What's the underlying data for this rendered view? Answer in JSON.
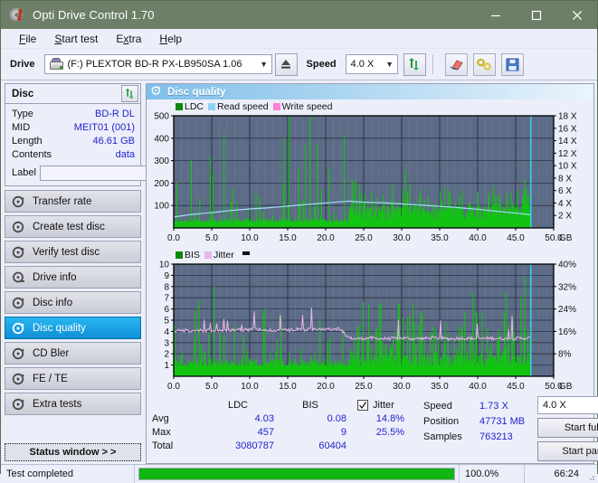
{
  "window": {
    "title": "Opti Drive Control 1.70",
    "icon": "disc-icon",
    "controls": {
      "minimize": "minimize-icon",
      "maximize": "maximize-icon",
      "close": "close-icon"
    }
  },
  "menubar": {
    "items": [
      {
        "label": "File",
        "accel": "F"
      },
      {
        "label": "Start test",
        "accel": "S"
      },
      {
        "label": "Extra",
        "accel": "x"
      },
      {
        "label": "Help",
        "accel": "H"
      }
    ]
  },
  "toolbar": {
    "drive_label": "Drive",
    "drive_value": "(F:)   PLEXTOR BD-R  PX-LB950SA 1.06",
    "eject_icon": "eject-icon",
    "speed_label": "Speed",
    "speed_value": "4.0 X",
    "refresh_icon": "refresh-icon",
    "erase_icon": "eraser-icon",
    "tools_icon": "tools-icon",
    "save_icon": "save-icon"
  },
  "disc": {
    "header": "Disc",
    "refresh_icon": "refresh-icon",
    "rows": [
      {
        "key": "Type",
        "value": "BD-R DL"
      },
      {
        "key": "MID",
        "value": "MEIT01 (001)"
      },
      {
        "key": "Length",
        "value": "46.61 GB"
      },
      {
        "key": "Contents",
        "value": "data"
      }
    ],
    "label_key": "Label",
    "label_value": "",
    "label_placeholder": "",
    "label_button_icon": "cd-icon"
  },
  "nav": {
    "items": [
      {
        "label": "Transfer rate",
        "icon": "disc-test-icon",
        "active": false
      },
      {
        "label": "Create test disc",
        "icon": "disc-burn-icon",
        "active": false
      },
      {
        "label": "Verify test disc",
        "icon": "disc-verify-icon",
        "active": false
      },
      {
        "label": "Drive info",
        "icon": "drive-info-icon",
        "active": false
      },
      {
        "label": "Disc info",
        "icon": "disc-info-icon",
        "active": false
      },
      {
        "label": "Disc quality",
        "icon": "disc-quality-icon",
        "active": true
      },
      {
        "label": "CD Bler",
        "icon": "cd-bler-icon",
        "active": false
      },
      {
        "label": "FE / TE",
        "icon": "fe-te-icon",
        "active": false
      },
      {
        "label": "Extra tests",
        "icon": "extra-tests-icon",
        "active": false
      }
    ],
    "status_window_button": "Status window > >"
  },
  "panel": {
    "title": "Disc quality",
    "icon": "disc-quality-icon"
  },
  "chart_data": [
    {
      "type": "line",
      "name": "top-chart",
      "title": "",
      "legend": [
        {
          "label": "LDC",
          "color": "#0a8a0a"
        },
        {
          "label": "Read speed",
          "color": "#8fd3f4"
        },
        {
          "label": "Write speed",
          "color": "#ff7fd4"
        }
      ],
      "legend_position": "top-left",
      "xlabel": "GB",
      "x": [
        0.0,
        5.0,
        10.0,
        15.0,
        20.0,
        25.0,
        30.0,
        35.0,
        40.0,
        45.0,
        50.0
      ],
      "xlim": [
        0,
        50
      ],
      "ylabel_left": "LDC",
      "ylim": [
        0,
        500
      ],
      "yticks_left": [
        100,
        200,
        300,
        400,
        500
      ],
      "ylabel_right": "Speed",
      "yticks_right": [
        "2 X",
        "4 X",
        "6 X",
        "8 X",
        "10 X",
        "12 X",
        "14 X",
        "16 X",
        "18 X"
      ],
      "ylim_right": [
        0,
        18
      ],
      "grid": true,
      "series": [
        {
          "name": "LDC",
          "color": "#13c413",
          "style": "bars",
          "note": "dense green spike bars across 0-47 GB, baseline ~20-60, peaks up to 457",
          "peak": 457,
          "avg": 4.03
        },
        {
          "name": "Read speed",
          "color": "#9fdcf7",
          "style": "line",
          "note": "rises from ~1.8X at 0 GB to ~4.3X at ~23 GB then declines to ~2.0X at 47 GB",
          "points": [
            [
              0.0,
              1.75
            ],
            [
              2.0,
              2.1
            ],
            [
              4.0,
              2.35
            ],
            [
              6.0,
              2.6
            ],
            [
              8.0,
              2.85
            ],
            [
              10.0,
              3.05
            ],
            [
              12.0,
              3.2
            ],
            [
              14.0,
              3.4
            ],
            [
              15.0,
              3.5
            ],
            [
              17.0,
              3.7
            ],
            [
              19.0,
              3.9
            ],
            [
              21.0,
              4.1
            ],
            [
              22.5,
              4.25
            ],
            [
              23.2,
              4.3
            ],
            [
              24.0,
              4.2
            ],
            [
              26.0,
              4.1
            ],
            [
              28.0,
              4.0
            ],
            [
              30.0,
              3.85
            ],
            [
              32.0,
              3.7
            ],
            [
              34.0,
              3.55
            ],
            [
              36.0,
              3.4
            ],
            [
              38.0,
              3.2
            ],
            [
              40.0,
              3.0
            ],
            [
              42.0,
              2.75
            ],
            [
              44.0,
              2.5
            ],
            [
              46.0,
              2.25
            ],
            [
              47.0,
              2.1
            ]
          ]
        },
        {
          "name": "Write speed",
          "color": "#ff7fd4",
          "style": "line",
          "note": "not plotted in this test"
        }
      ],
      "cursor_x": 47.0,
      "cursor_color": "#35d7f5",
      "plot_bg": "#5c6b86"
    },
    {
      "type": "line",
      "name": "bottom-chart",
      "title": "",
      "legend": [
        {
          "label": "BIS",
          "color": "#0a8a0a"
        },
        {
          "label": "Jitter",
          "color": "#e8b6e8"
        }
      ],
      "legend_position": "top-left",
      "xlabel": "GB",
      "x": [
        0.0,
        5.0,
        10.0,
        15.0,
        20.0,
        25.0,
        30.0,
        35.0,
        40.0,
        45.0,
        50.0
      ],
      "xlim": [
        0,
        50
      ],
      "ylabel_left": "BIS",
      "ylim": [
        0,
        10
      ],
      "yticks_left": [
        1,
        2,
        3,
        4,
        5,
        6,
        7,
        8,
        9,
        10
      ],
      "ylabel_right": "Jitter",
      "yticks_right": [
        "8%",
        "16%",
        "24%",
        "32%",
        "40%"
      ],
      "ylim_right": [
        0,
        40
      ],
      "grid": true,
      "series": [
        {
          "name": "BIS",
          "color": "#13c413",
          "style": "bars",
          "note": "dense green bars baseline ~1, spikes up to 9",
          "peak": 9,
          "avg": 0.08
        },
        {
          "name": "Jitter",
          "color": "#e8b6e8",
          "style": "line",
          "note": "flat around 4.0-4.2 (≈14.8%) with spikes to 6-7 (≈25.5%), drops to ~3.3 after 23 GB",
          "avg_pct": "14.8%",
          "max_pct": "25.5%",
          "points": [
            [
              0.0,
              4.0
            ],
            [
              1.0,
              4.1
            ],
            [
              2.0,
              4.05
            ],
            [
              3.0,
              4.1
            ],
            [
              4.0,
              4.05
            ],
            [
              5.0,
              4.1
            ],
            [
              6.0,
              4.15
            ],
            [
              7.0,
              4.1
            ],
            [
              8.0,
              4.15
            ],
            [
              9.0,
              4.1
            ],
            [
              10.0,
              4.15
            ],
            [
              11.0,
              4.2
            ],
            [
              12.0,
              4.15
            ],
            [
              13.0,
              4.1
            ],
            [
              14.0,
              4.15
            ],
            [
              15.0,
              4.1
            ],
            [
              16.0,
              4.2
            ],
            [
              17.0,
              4.15
            ],
            [
              18.0,
              4.2
            ],
            [
              19.0,
              4.15
            ],
            [
              20.0,
              4.2
            ],
            [
              21.0,
              4.25
            ],
            [
              22.0,
              4.2
            ],
            [
              23.0,
              3.4
            ],
            [
              24.0,
              3.35
            ],
            [
              26.0,
              3.4
            ],
            [
              28.0,
              3.35
            ],
            [
              30.0,
              3.4
            ],
            [
              32.0,
              3.35
            ],
            [
              34.0,
              3.4
            ],
            [
              36.0,
              3.35
            ],
            [
              38.0,
              3.4
            ],
            [
              40.0,
              3.35
            ],
            [
              42.0,
              3.4
            ],
            [
              44.0,
              3.35
            ],
            [
              46.0,
              3.4
            ],
            [
              47.0,
              3.4
            ]
          ]
        }
      ],
      "cursor_x": 47.0,
      "cursor_color": "#35d7f5",
      "plot_bg": "#5c6b86"
    }
  ],
  "stats": {
    "col_ldc": "LDC",
    "col_bis": "BIS",
    "rows": [
      {
        "key": "Avg",
        "ldc": "4.03",
        "bis": "0.08"
      },
      {
        "key": "Max",
        "ldc": "457",
        "bis": "9"
      },
      {
        "key": "Total",
        "ldc": "3080787",
        "bis": "60404"
      }
    ],
    "jitter_checkbox_label": "Jitter",
    "jitter_checked": true,
    "jitter_avg": "14.8%",
    "jitter_max": "25.5%",
    "speed_key": "Speed",
    "speed_value": "1.73 X",
    "position_key": "Position",
    "position_value": "47731 MB",
    "samples_key": "Samples",
    "samples_value": "763213",
    "speed_select": "4.0 X",
    "start_full": "Start full",
    "start_part": "Start part"
  },
  "statusbar": {
    "message": "Test completed",
    "progress_pct": "100.0%",
    "progress_value": 100,
    "elapsed": "66:24"
  },
  "colors": {
    "titlebar": "#6d7f66",
    "accent": "#1f9ad6",
    "value_text": "#2222cc",
    "plot_bg": "#5c6b86",
    "green": "#13c413",
    "progress_green": "#12b512"
  }
}
